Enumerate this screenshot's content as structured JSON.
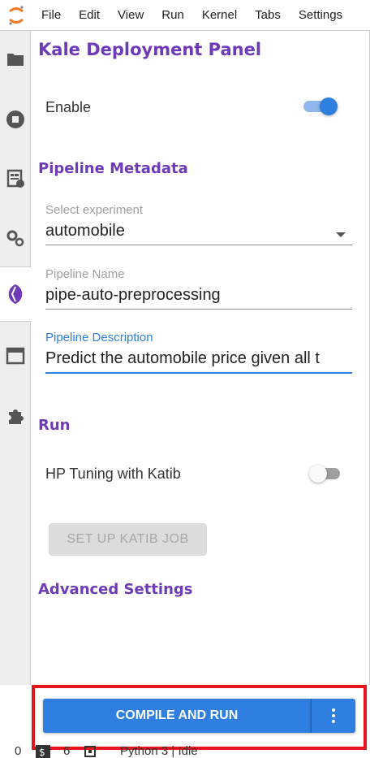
{
  "menubar": {
    "items": [
      "File",
      "Edit",
      "View",
      "Run",
      "Kernel",
      "Tabs",
      "Settings"
    ]
  },
  "leftbar": {
    "icons": [
      "folder-icon",
      "stop-circle-icon",
      "command-palette-icon",
      "settings-gears-icon",
      "kale-leaf-icon",
      "tabs-window-icon",
      "extension-puzzle-icon"
    ],
    "active": "kale-leaf-icon"
  },
  "panel": {
    "title": "Kale Deployment Panel",
    "enable_label": "Enable",
    "enable_on": true,
    "metadata_title": "Pipeline Metadata",
    "experiment": {
      "label": "Select experiment",
      "value": "automobile"
    },
    "pipeline_name": {
      "label": "Pipeline Name",
      "value": "pipe-auto-preprocessing"
    },
    "pipeline_description": {
      "label": "Pipeline Description",
      "value": "Predict the automobile price given all t"
    },
    "run_title": "Run",
    "katib_label": "HP Tuning with Katib",
    "katib_on": false,
    "katib_button": "SET UP KATIB JOB",
    "advanced_title": "Advanced Settings"
  },
  "actions": {
    "compile_label": "COMPILE AND RUN",
    "more_icon": "more-vertical-icon"
  },
  "statusbar": {
    "count_a": "0",
    "count_b": "6",
    "kernel": "Python 3 | Idle"
  },
  "colors": {
    "accent": "#2f7fe0",
    "brand_purple": "#6f3ab8",
    "highlight_red": "#e8141b"
  }
}
